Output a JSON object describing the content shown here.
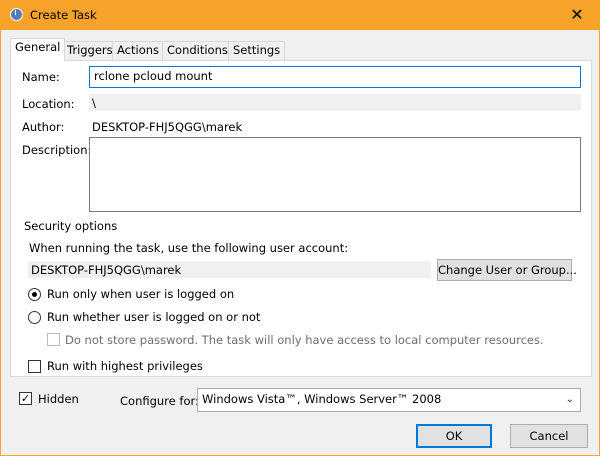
{
  "window": {
    "title": "Create Task",
    "close_glyph": "✕",
    "title_icon": "clock-icon",
    "accent": "#f7a22b"
  },
  "tabs": [
    {
      "label": "General"
    },
    {
      "label": "Triggers"
    },
    {
      "label": "Actions"
    },
    {
      "label": "Conditions"
    },
    {
      "label": "Settings"
    }
  ],
  "general": {
    "name_label": "Name:",
    "name_value": "rclone pcloud mount",
    "location_label": "Location:",
    "location_value": "\\",
    "author_label": "Author:",
    "author_value": "DESKTOP-FHJ5QGG\\marek",
    "description_label": "Description:",
    "description_value": ""
  },
  "security": {
    "legend": "Security options",
    "account_prompt": "When running the task, use the following user account:",
    "account_value": "DESKTOP-FHJ5QGG\\marek",
    "change_button": "Change User or Group...",
    "radio_logged_on": "Run only when user is logged on",
    "radio_whether": "Run whether user is logged on or not",
    "no_store_password": "Do not store password.  The task will only have access to local computer resources.",
    "highest_privileges": "Run with highest privileges"
  },
  "footer": {
    "hidden_label": "Hidden",
    "hidden_checked_glyph": "✓",
    "configure_label": "Configure for:",
    "configure_value": "Windows Vista™, Windows Server™ 2008",
    "chevron": "⌄",
    "ok_button": "OK",
    "cancel_button": "Cancel"
  }
}
